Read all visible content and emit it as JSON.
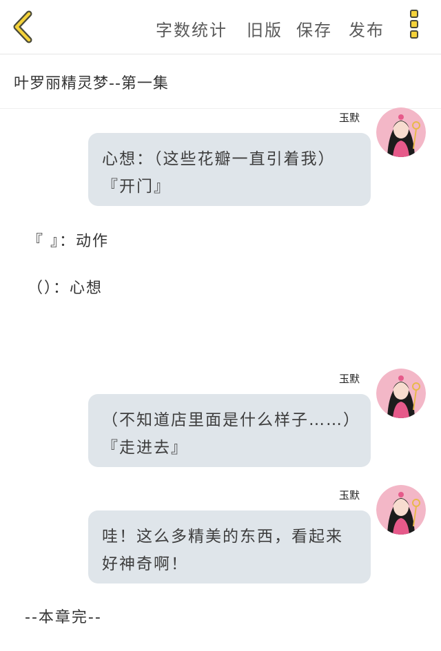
{
  "toolbar": {
    "word_count": "字数统计",
    "old_version": "旧版",
    "save": "保存",
    "publish": "发布"
  },
  "story": {
    "title": "叶罗丽精灵梦--第一集"
  },
  "messages": [
    {
      "speaker": "玉默",
      "text": "心想：（这些花瓣一直引着我）『开门』"
    },
    {
      "speaker": "玉默",
      "text": "（不知道店里面是什么样子……）『走进去』"
    },
    {
      "speaker": "玉默",
      "text": "哇！这么多精美的东西，看起来好神奇啊！"
    }
  ],
  "legend": {
    "action": "『 』：动作",
    "thought": "（）：心想"
  },
  "footer": {
    "end_text": "--本章完--"
  },
  "colors": {
    "accent": "#f4d23a",
    "bubble": "#dfe5ea",
    "avatar_bg": "#f3b7c7"
  },
  "icons": {
    "back": "chevron-left-icon",
    "menu": "vertical-dots-menu-icon"
  }
}
